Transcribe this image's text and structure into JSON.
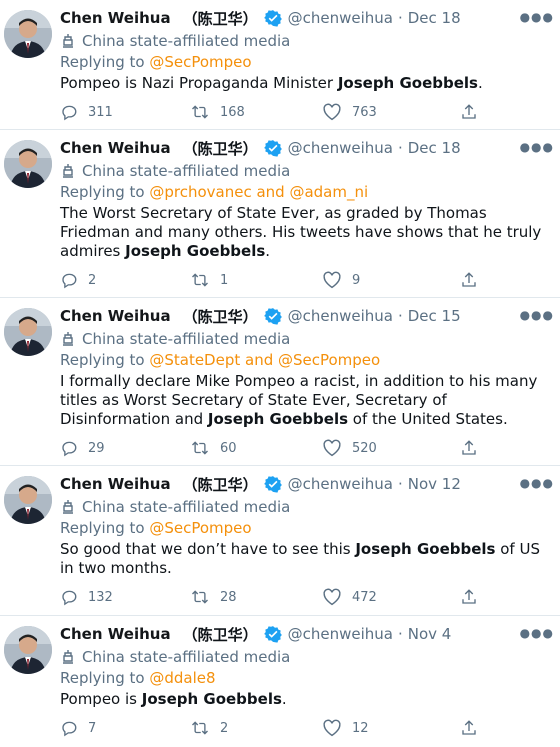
{
  "tweets": [
    {
      "name": "Chen Weihua",
      "name_cn": "（陈卫华）",
      "handle": "@chenweihua",
      "dot": "·",
      "date": "Dec 18",
      "label": "China state-affiliated media",
      "reply_prefix": "Replying to",
      "reply_to": " @SecPompeo",
      "text_pre": "Pompeo is Nazi Propaganda Minister ",
      "text_bold": "Joseph Goebbels",
      "text_post": ".",
      "replies": "311",
      "retweets": "168",
      "likes": "763"
    },
    {
      "name": "Chen Weihua",
      "name_cn": "（陈卫华）",
      "handle": "@chenweihua",
      "dot": "·",
      "date": "Dec 18",
      "label": "China state-affiliated media",
      "reply_prefix": "Replying to",
      "reply_to": " @prchovanec and @adam_ni",
      "text_pre": "The Worst Secretary of State Ever, as graded by Thomas Friedman and many others.  His tweets have shows that he truly admires ",
      "text_bold": "Joseph Goebbels",
      "text_post": ".",
      "replies": "2",
      "retweets": "1",
      "likes": "9"
    },
    {
      "name": "Chen Weihua",
      "name_cn": "（陈卫华）",
      "handle": "@chenweihua",
      "dot": "·",
      "date": "Dec 15",
      "label": "China state-affiliated media",
      "reply_prefix": "Replying to",
      "reply_to": " @StateDept and @SecPompeo",
      "text_pre": "I formally declare Mike Pompeo a racist, in addition to his many titles as Worst Secretary of State Ever, Secretary of Disinformation and ",
      "text_bold": "Joseph Goebbels",
      "text_post": " of the United States.",
      "replies": "29",
      "retweets": "60",
      "likes": "520"
    },
    {
      "name": "Chen Weihua",
      "name_cn": "（陈卫华）",
      "handle": "@chenweihua",
      "dot": "·",
      "date": "Nov 12",
      "label": "China state-affiliated media",
      "reply_prefix": "Replying to",
      "reply_to": " @SecPompeo",
      "text_pre": "So good that we don’t have to see this ",
      "text_bold": "Joseph Goebbels",
      "text_post": " of US in two months.",
      "replies": "132",
      "retweets": "28",
      "likes": "472"
    },
    {
      "name": "Chen Weihua",
      "name_cn": "（陈卫华）",
      "handle": "@chenweihua",
      "dot": "·",
      "date": "Nov 4",
      "label": "China state-affiliated media",
      "reply_prefix": "Replying to",
      "reply_to": " @ddale8",
      "text_pre": "Pompeo is ",
      "text_bold": "Joseph Goebbels",
      "text_post": ".",
      "replies": "7",
      "retweets": "2",
      "likes": "12"
    }
  ],
  "more_icon": "more-horizontal-icon",
  "accent_color": "#f4900c",
  "muted_color": "#5b7083",
  "verified_color": "#1da1f2"
}
